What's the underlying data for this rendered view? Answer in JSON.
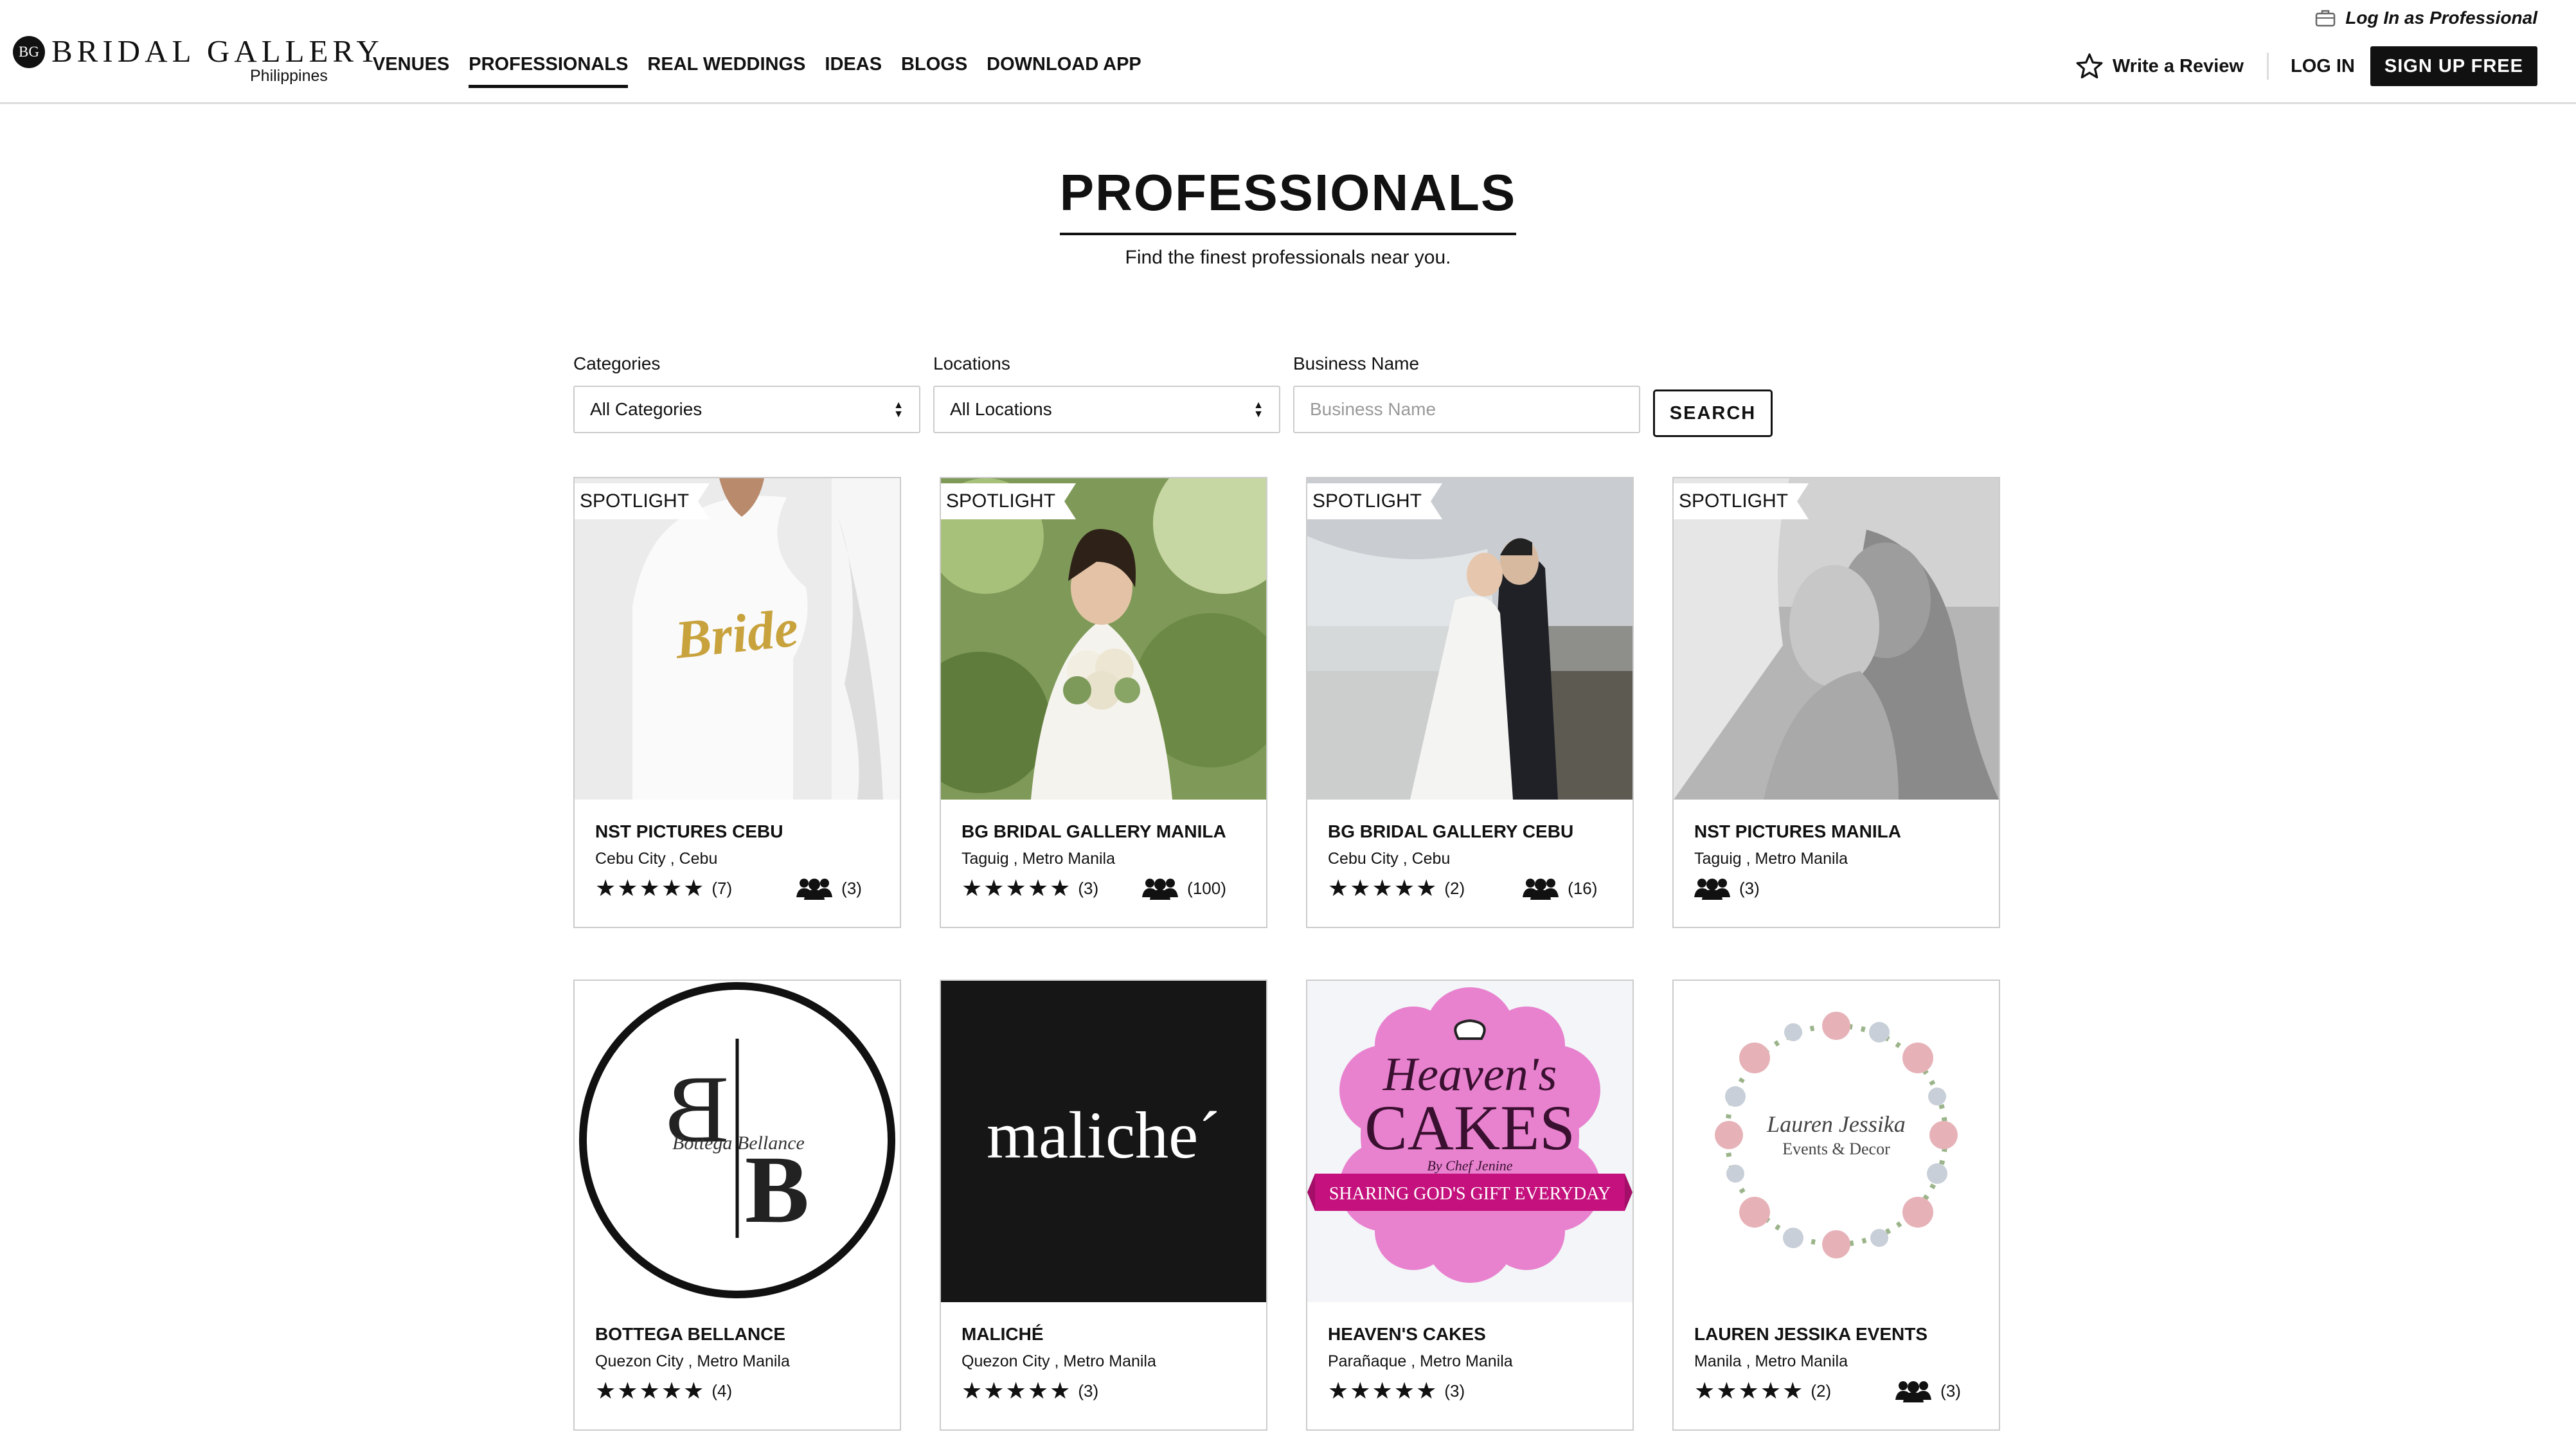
{
  "header": {
    "logo_mark": "BG",
    "logo_text": "BRIDAL GALLERY",
    "logo_sub": "Philippines",
    "nav": [
      "VENUES",
      "PROFESSIONALS",
      "REAL WEDDINGS",
      "IDEAS",
      "BLOGS",
      "DOWNLOAD APP"
    ],
    "active_nav": "PROFESSIONALS",
    "pro_login": "Log In as Professional",
    "write_review": "Write a Review",
    "login": "LOG IN",
    "signup": "SIGN UP FREE"
  },
  "hero": {
    "title": "PROFESSIONALS",
    "subtitle": "Find the finest professionals near you."
  },
  "filters": {
    "categories_label": "Categories",
    "categories_value": "All Categories",
    "locations_label": "Locations",
    "locations_value": "All Locations",
    "business_label": "Business Name",
    "business_placeholder": "Business Name",
    "search_label": "SEARCH"
  },
  "cards": [
    {
      "spotlight": "SPOTLIGHT",
      "name": "NST PICTURES CEBU",
      "location": "Cebu City , Cebu",
      "rating": 5,
      "stars": "★★★★★",
      "reviews": "(7)",
      "group": "(3)",
      "image_text": "Bride"
    },
    {
      "spotlight": "SPOTLIGHT",
      "name": "BG BRIDAL GALLERY MANILA",
      "location": "Taguig , Metro Manila",
      "rating": 5,
      "stars": "★★★★★",
      "reviews": "(3)",
      "group": "(100)"
    },
    {
      "spotlight": "SPOTLIGHT",
      "name": "BG BRIDAL GALLERY CEBU",
      "location": "Cebu City , Cebu",
      "rating": 5,
      "stars": "★★★★★",
      "reviews": "(2)",
      "group": "(16)"
    },
    {
      "spotlight": "SPOTLIGHT",
      "name": "NST PICTURES MANILA",
      "location": "Taguig , Metro Manila",
      "group": "(3)"
    },
    {
      "name": "BOTTEGA BELLANCE",
      "location": "Quezon City , Metro Manila",
      "rating": 5,
      "stars": "★★★★★",
      "reviews": "(4)",
      "image_text": "B B",
      "image_script": "Bottega Bellance"
    },
    {
      "name": "MALICHÉ",
      "location": "Quezon City , Metro Manila",
      "rating": 5,
      "stars": "★★★★★",
      "reviews": "(3)",
      "image_text": "maliche´"
    },
    {
      "name": "HEAVEN'S CAKES",
      "location": "Parañaque , Metro Manila",
      "rating": 5,
      "stars": "★★★★★",
      "reviews": "(3)",
      "image_text": "Heaven's",
      "image_text2": "CAKES",
      "image_script": "By Chef Jenine",
      "image_banner": "SHARING GOD'S GIFT EVERYDAY"
    },
    {
      "name": "LAUREN JESSIKA EVENTS",
      "location": "Manila , Metro Manila",
      "rating": 5,
      "stars": "★★★★★",
      "reviews": "(2)",
      "group": "(3)",
      "image_text": "Lauren Jessika",
      "image_text2": "Events & Decor"
    }
  ]
}
